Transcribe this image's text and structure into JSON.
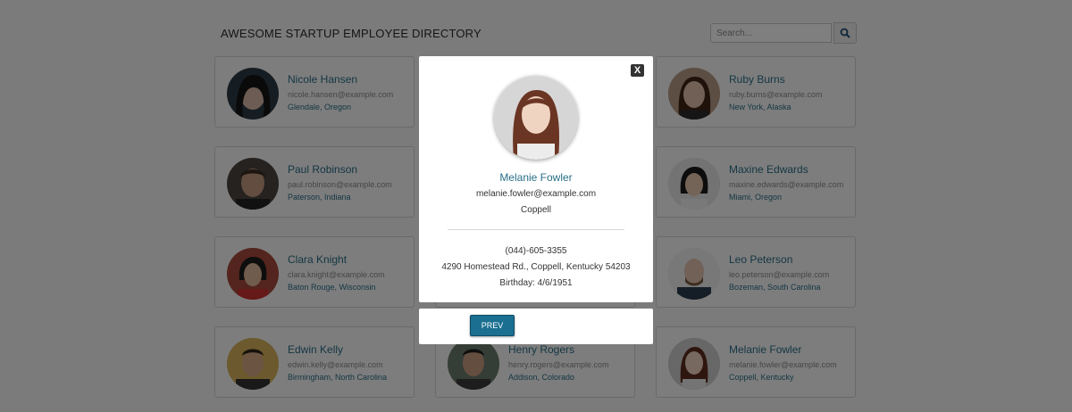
{
  "header": {
    "title": "AWESOME STARTUP EMPLOYEE DIRECTORY"
  },
  "search": {
    "placeholder": "Search...",
    "icon": "search-icon"
  },
  "employees": [
    {
      "name": "Nicole Hansen",
      "email": "nicole.hansen@example.com",
      "location": "Glendale, Oregon"
    },
    {
      "name": "",
      "email": "",
      "location": ""
    },
    {
      "name": "Ruby Burns",
      "email": "ruby.burns@example.com",
      "location": "New York, Alaska"
    },
    {
      "name": "Paul Robinson",
      "email": "paul.robinson@example.com",
      "location": "Paterson, Indiana"
    },
    {
      "name": "",
      "email": "",
      "location": ""
    },
    {
      "name": "Maxine Edwards",
      "email": "maxine.edwards@example.com",
      "location": "Miami, Oregon"
    },
    {
      "name": "Clara Knight",
      "email": "clara.knight@example.com",
      "location": "Baton Rouge, Wisconsin"
    },
    {
      "name": "",
      "email": "",
      "location": ""
    },
    {
      "name": "Leo Peterson",
      "email": "leo.peterson@example.com",
      "location": "Bozeman, South Carolina"
    },
    {
      "name": "Edwin Kelly",
      "email": "edwin.kelly@example.com",
      "location": "Birmingham, North Carolina"
    },
    {
      "name": "Henry Rogers",
      "email": "henry.rogers@example.com",
      "location": "Addison, Colorado"
    },
    {
      "name": "Melanie Fowler",
      "email": "melanie.fowler@example.com",
      "location": "Coppell, Kentucky"
    }
  ],
  "modal": {
    "close_label": "X",
    "name": "Melanie Fowler",
    "email": "melanie.fowler@example.com",
    "city": "Coppell",
    "phone": "(044)-605-3355",
    "address": "4290 Homestead Rd., Coppell, Kentucky 54203",
    "birthday": "Birthday: 4/6/1951",
    "prev_label": "PREV"
  },
  "colors": {
    "accent": "#2a6f88",
    "button": "#1b6f91",
    "overlay": "rgba(0,0,0,0.5)"
  }
}
